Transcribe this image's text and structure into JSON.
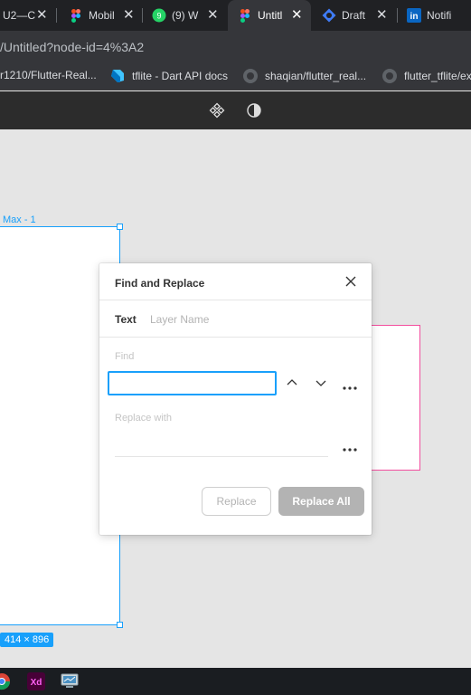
{
  "browser": {
    "tabs": [
      {
        "title": "U2—C",
        "icon": "page-icon",
        "active": false
      },
      {
        "title": "Mobil",
        "icon": "figma-icon",
        "active": false
      },
      {
        "title": "(9) W",
        "icon": "whatsapp-icon",
        "active": false
      },
      {
        "title": "Untitl",
        "icon": "figma-icon",
        "active": true
      },
      {
        "title": "Draft",
        "icon": "draft-icon",
        "active": false
      },
      {
        "title": "Notifi",
        "icon": "linkedin-icon",
        "active": false
      }
    ],
    "url": "/Untitled?node-id=4%3A2",
    "bookmarks": [
      {
        "label": "r1210/Flutter-Real...",
        "icon": "github-icon"
      },
      {
        "label": "tflite - Dart API docs",
        "icon": "dart-icon"
      },
      {
        "label": "shaqian/flutter_real...",
        "icon": "github-icon"
      },
      {
        "label": "flutter_tflite/ex",
        "icon": "github-icon"
      }
    ]
  },
  "toolbar": {
    "icons": [
      "components-icon",
      "theme-contrast-icon"
    ]
  },
  "canvas": {
    "frame_label": "Max - 1",
    "frame_size": "414 × 896",
    "colors": {
      "selection": "#18a0fb",
      "pink_frame": "#f24e9e",
      "canvas_bg": "#e5e5e5"
    }
  },
  "dialog": {
    "title": "Find and Replace",
    "tabs": {
      "text": "Text",
      "layer_name": "Layer Name"
    },
    "find_label": "Find",
    "find_value": "",
    "replace_label": "Replace with",
    "replace_value": "",
    "replace_button": "Replace",
    "replace_all_button": "Replace All"
  },
  "taskbar": {
    "icons": [
      "chrome-icon",
      "adobe-xd-icon",
      "monitor-app-icon"
    ],
    "xd_label": "Xd"
  }
}
